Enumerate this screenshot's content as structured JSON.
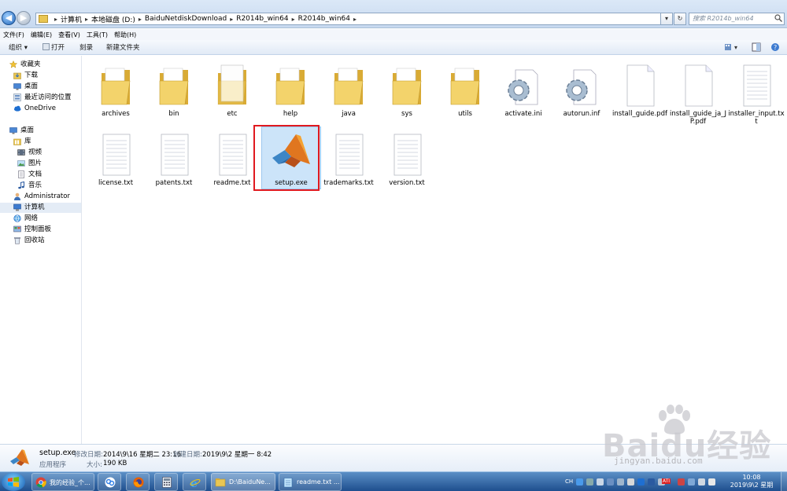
{
  "address": {
    "crumbs": [
      "计算机",
      "本地磁盘 (D:)",
      "BaiduNetdiskDownload",
      "R2014b_win64",
      "R2014b_win64"
    ],
    "search_placeholder": "搜索 R2014b_win64"
  },
  "menu": [
    "文件(F)",
    "编辑(E)",
    "查看(V)",
    "工具(T)",
    "帮助(H)"
  ],
  "toolbar": {
    "organize": "组织 ▾",
    "open": "打开",
    "burn": "刻录",
    "new_folder": "新建文件夹"
  },
  "sidebar": {
    "favorites": "收藏夹",
    "downloads": "下载",
    "desktop1": "桌面",
    "recent": "最近访问的位置",
    "onedrive": "OneDrive",
    "desktop2": "桌面",
    "library": "库",
    "videos": "视频",
    "pictures": "图片",
    "documents": "文档",
    "music": "音乐",
    "admin": "Administrator",
    "computer": "计算机",
    "network": "网络",
    "control_panel": "控制面板",
    "recycle_bin": "回收站"
  },
  "files": [
    {
      "name": "archives",
      "kind": "folder"
    },
    {
      "name": "bin",
      "kind": "folder"
    },
    {
      "name": "etc",
      "kind": "folder-doc"
    },
    {
      "name": "help",
      "kind": "folder"
    },
    {
      "name": "java",
      "kind": "folder"
    },
    {
      "name": "sys",
      "kind": "folder"
    },
    {
      "name": "utils",
      "kind": "folder"
    },
    {
      "name": "activate.ini",
      "kind": "settings"
    },
    {
      "name": "autorun.inf",
      "kind": "settings"
    },
    {
      "name": "install_guide.pdf",
      "kind": "doc"
    },
    {
      "name": "install_guide_ja_JP.pdf",
      "kind": "doc"
    },
    {
      "name": "installer_input.txt",
      "kind": "txt"
    },
    {
      "name": "license.txt",
      "kind": "txt"
    },
    {
      "name": "patents.txt",
      "kind": "txt"
    },
    {
      "name": "readme.txt",
      "kind": "txt"
    },
    {
      "name": "setup.exe",
      "kind": "matlab"
    },
    {
      "name": "trademarks.txt",
      "kind": "txt"
    },
    {
      "name": "version.txt",
      "kind": "txt"
    }
  ],
  "details": {
    "filename": "setup.exe",
    "type": "应用程序",
    "modified_label": "修改日期:",
    "modified": "2014\\9\\16 星期二 23:16",
    "created_label": "创建日期:",
    "created": "2019\\9\\2 星期一 8:42",
    "size_label": "大小:",
    "size": "190 KB"
  },
  "watermark": {
    "brand": "Baidu经验",
    "url": "jingyan.baidu.com"
  },
  "taskbar": {
    "chrome": "我的经验_个...",
    "explorer": "D:\\BaiduNe...",
    "notepad": "readme.txt ...",
    "tray_lang": "CH",
    "tray_badge": "ATI",
    "time": "10:08",
    "date": "2019\\9\\2 星期一"
  },
  "colors": {
    "accent": "#cce4f9",
    "highlight_border": "#e0191f",
    "taskbar": "#1e4f8e"
  }
}
